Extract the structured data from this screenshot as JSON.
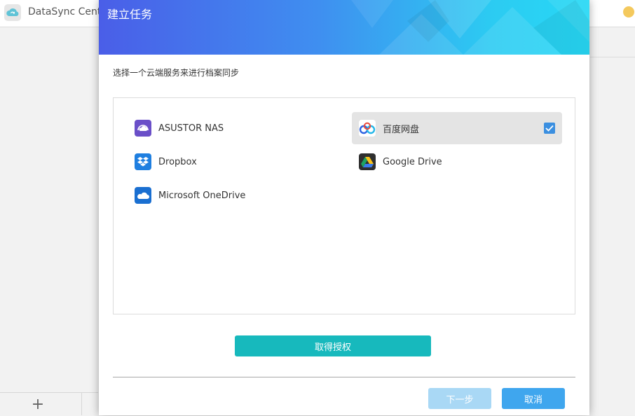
{
  "app": {
    "title": "DataSync Center",
    "add_label": "+"
  },
  "dialog": {
    "title": "建立任务",
    "instruction": "选择一个云端服务来进行档案同步",
    "services": [
      {
        "label": "ASUSTOR NAS",
        "icon": "asustor-nas-icon",
        "selected": false
      },
      {
        "label": "百度网盘",
        "icon": "baidu-netdisk-icon",
        "selected": true
      },
      {
        "label": "Dropbox",
        "icon": "dropbox-icon",
        "selected": false
      },
      {
        "label": "Google Drive",
        "icon": "google-drive-icon",
        "selected": false
      },
      {
        "label": "Microsoft OneDrive",
        "icon": "onedrive-icon",
        "selected": false
      }
    ],
    "auth_label": "取得授权",
    "next_label": "下一步",
    "cancel_label": "取消"
  },
  "colors": {
    "auth_button": "#17b9bd",
    "next_button_disabled": "#a9d8f5",
    "cancel_button": "#3fa6ee",
    "check": "#3b8fe0",
    "header_start": "#4a5ee8",
    "header_end": "#27d8f5"
  }
}
